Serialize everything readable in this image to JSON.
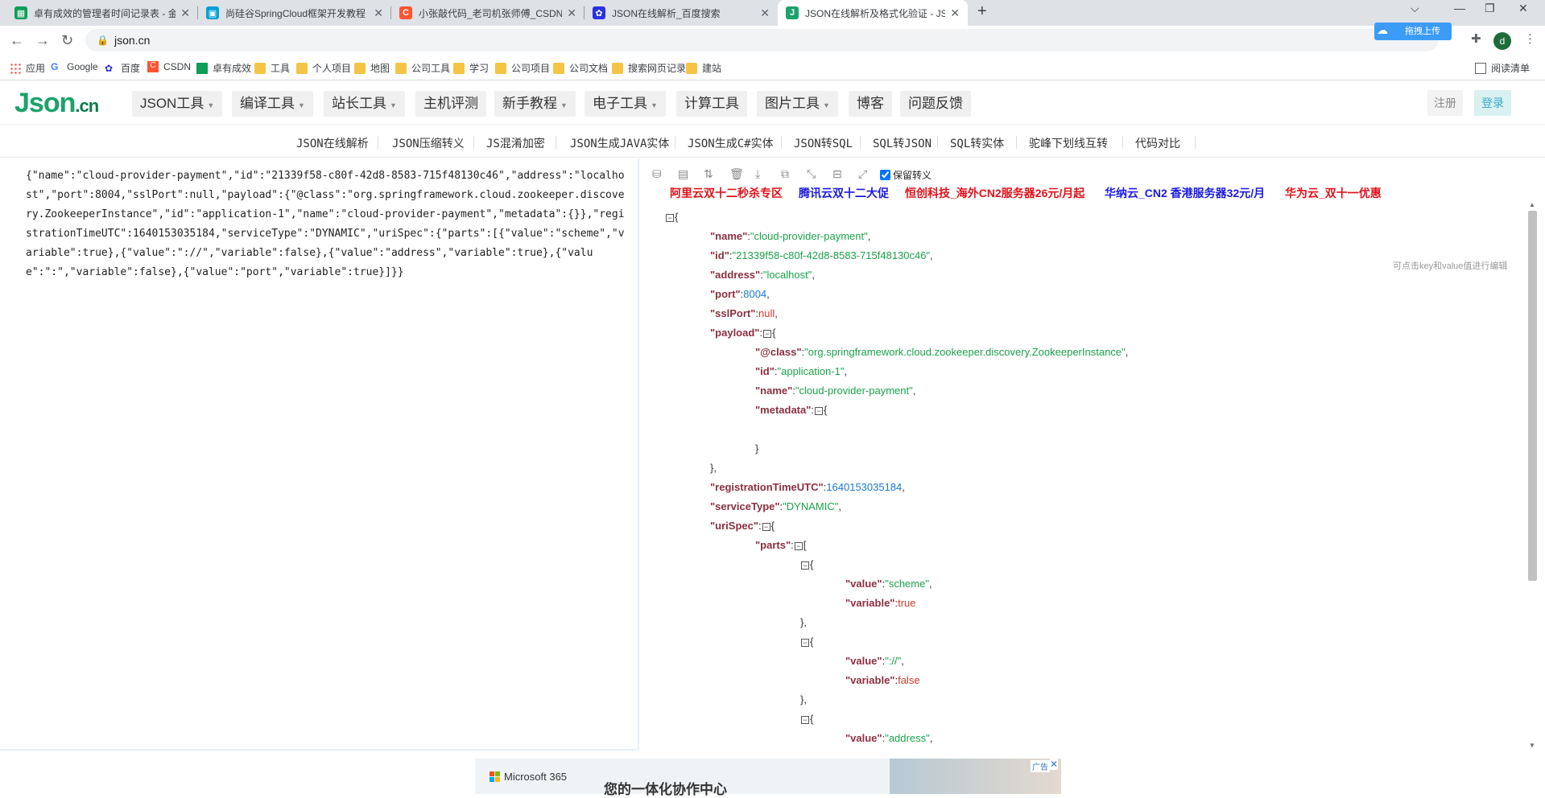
{
  "browser": {
    "tabs": [
      {
        "title": "卓有成效的管理者时间记录表 - 金",
        "favicon_color": "#0f9d58"
      },
      {
        "title": "尚硅谷SpringCloud框架开发教程",
        "favicon_color": "#00a1d6"
      },
      {
        "title": "小张敲代码_老司机张师傅_CSDN",
        "favicon_color": "#fc5531"
      },
      {
        "title": "JSON在线解析_百度搜索",
        "favicon_color": "#2932e1"
      },
      {
        "title": "JSON在线解析及格式化验证 - JS",
        "favicon_color": "#1aa36a"
      }
    ],
    "url": "json.cn",
    "upload_ext_label": "拖拽上传",
    "avatar_letter": "d",
    "reading_list": "阅读清单"
  },
  "bookmarks": [
    "应用",
    "Google",
    "百度",
    "CSDN",
    "卓有成效",
    "工具",
    "个人项目",
    "地图",
    "公司工具",
    "学习",
    "公司项目",
    "公司文档",
    "搜索网页记录",
    "建站"
  ],
  "site": {
    "logo_main": "Json",
    "logo_suffix": ".cn",
    "menus": [
      "JSON工具",
      "编译工具",
      "站长工具",
      "主机评测",
      "新手教程",
      "电子工具",
      "计算工具",
      "图片工具",
      "博客",
      "问题反馈"
    ],
    "register": "注册",
    "login": "登录",
    "subnav": [
      "JSON在线解析",
      "JSON压缩转义",
      "JS混淆加密",
      "JSON生成JAVA实体",
      "JSON生成C#实体",
      "JSON转SQL",
      "SQL转JSON",
      "SQL转实体",
      "驼峰下划线互转",
      "代码对比"
    ]
  },
  "editor": {
    "raw_json": "{\"name\":\"cloud-provider-payment\",\"id\":\"21339f58-c80f-42d8-8583-715f48130c46\",\"address\":\"localhost\",\"port\":8004,\"sslPort\":null,\"payload\":{\"@class\":\"org.springframework.cloud.zookeeper.discovery.ZookeeperInstance\",\"id\":\"application-1\",\"name\":\"cloud-provider-payment\",\"metadata\":{}},\"registrationTimeUTC\":1640153035184,\"serviceType\":\"DYNAMIC\",\"uriSpec\":{\"parts\":[{\"value\":\"scheme\",\"variable\":true},{\"value\":\"://\",\"variable\":false},{\"value\":\"address\",\"variable\":true},{\"value\":\":\",\"variable\":false},{\"value\":\"port\",\"variable\":true}]}}",
    "keep_escape_label": "保留转义",
    "hint": "可点击key和value值进行编辑",
    "ads": [
      {
        "text": "阿里云双十二秒杀专区",
        "color": "#e0121a"
      },
      {
        "text": "腾讯云双十二大促",
        "color": "#1a1ae0"
      },
      {
        "text": "恒创科技_海外CN2服务器26元/月起",
        "color": "#e0121a"
      },
      {
        "text": "华纳云_CN2 香港服务器32元/月",
        "color": "#1a1ae0"
      },
      {
        "text": "华为云_双十一优惠",
        "color": "#e0121a"
      }
    ]
  },
  "bottom_ad": {
    "brand": "Microsoft 365",
    "slogan": "您的一体化协作中心",
    "badge": "广告"
  }
}
